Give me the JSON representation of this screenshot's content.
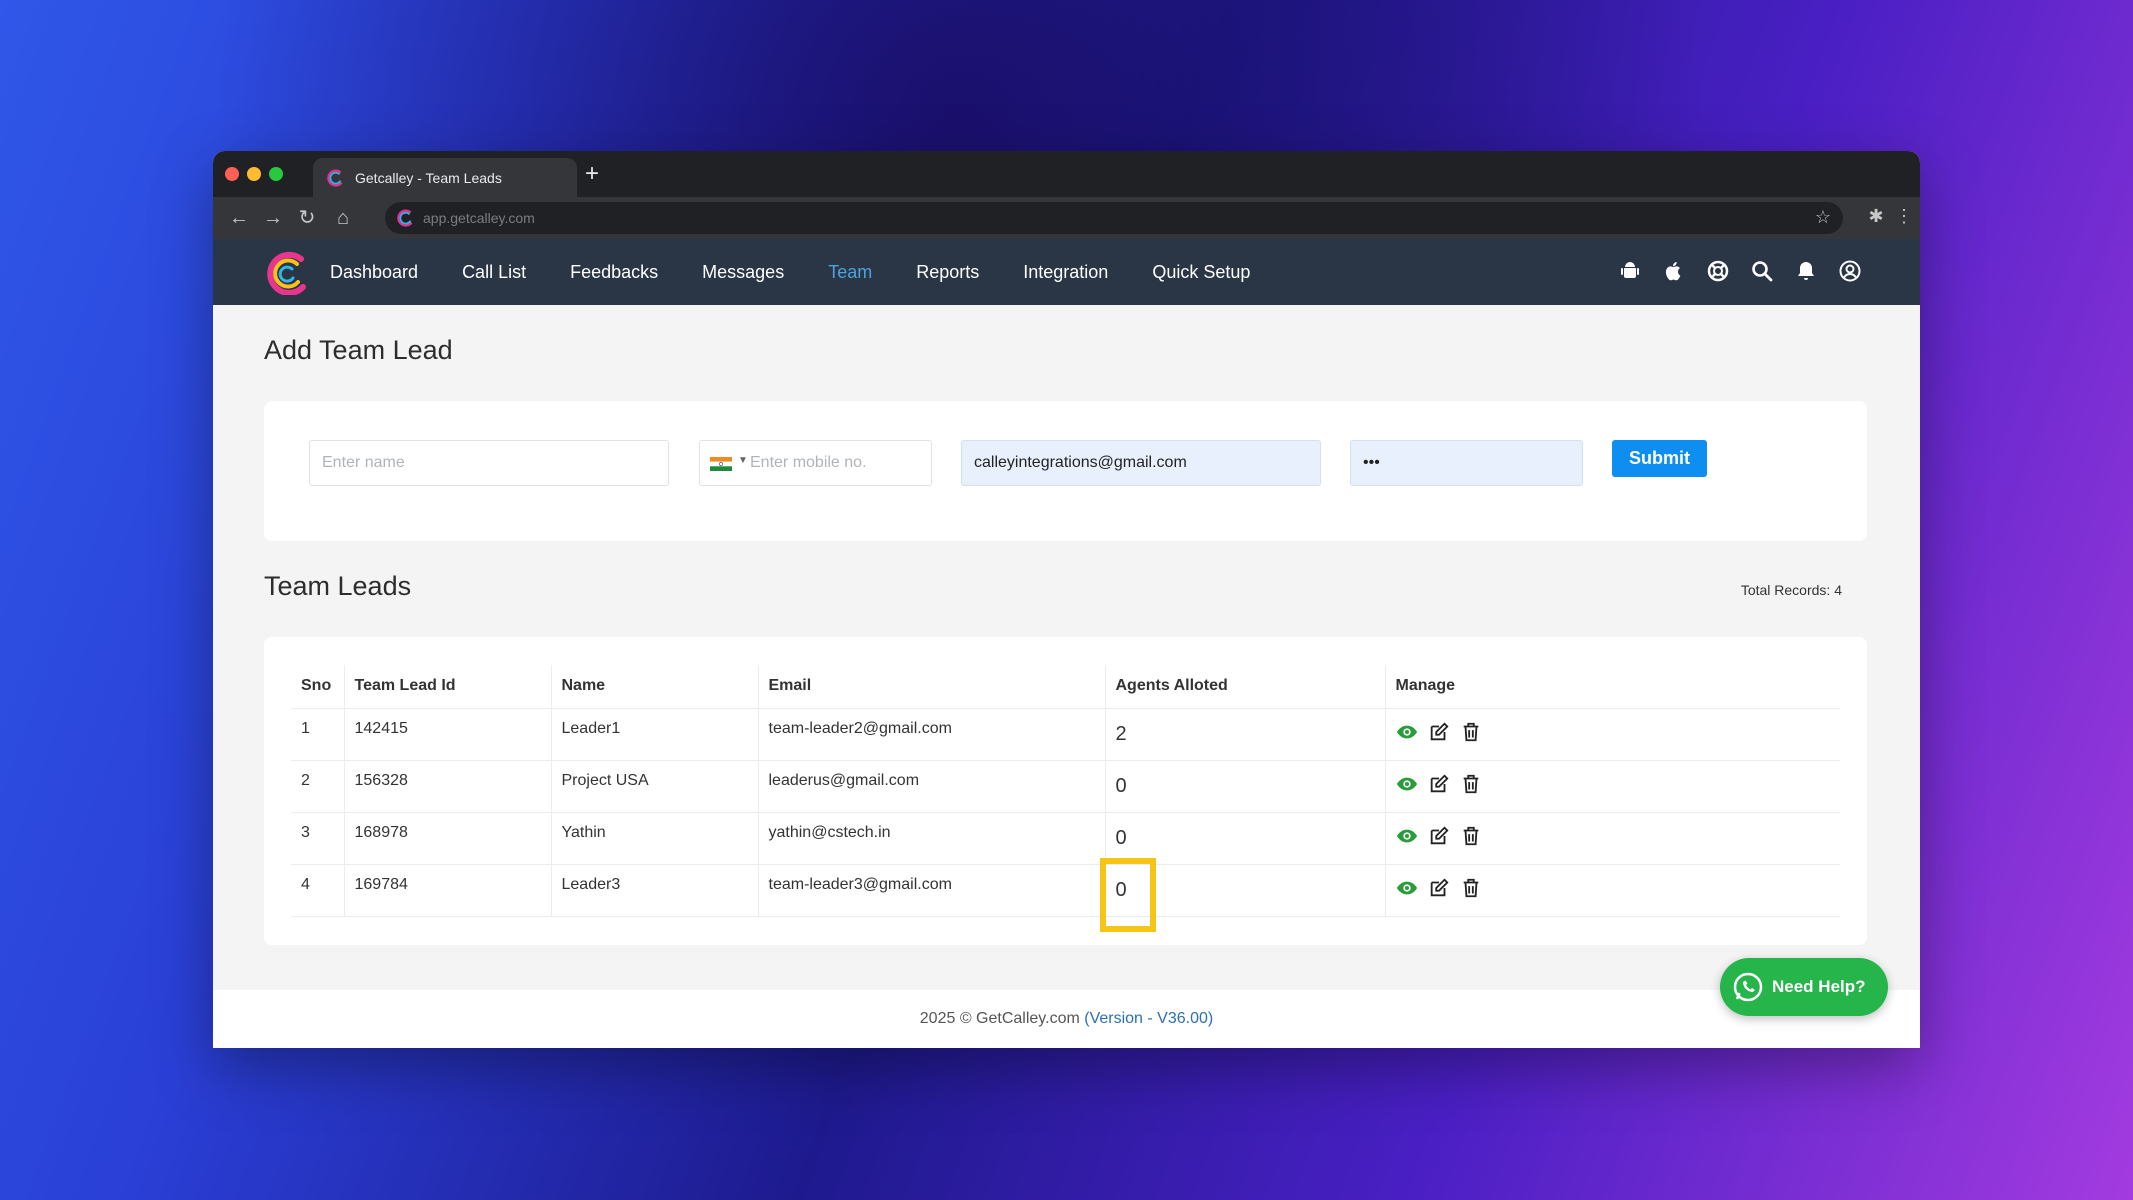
{
  "browser": {
    "tab_title": "Getcalley - Team Leads",
    "new_tab": "+",
    "url": "app.getcalley.com"
  },
  "nav": {
    "links": [
      "Dashboard",
      "Call List",
      "Feedbacks",
      "Messages",
      "Team",
      "Reports",
      "Integration",
      "Quick Setup"
    ],
    "active": "Team",
    "icons": [
      "android-icon",
      "apple-icon",
      "help-lifebuoy-icon",
      "search-icon",
      "bell-icon",
      "user-icon"
    ]
  },
  "form": {
    "title": "Add Team Lead",
    "name_placeholder": "Enter name",
    "mobile_placeholder": "Enter mobile no.",
    "email_value": "calleyintegrations@gmail.com",
    "password_value": "•••",
    "submit_label": "Submit"
  },
  "team_leads": {
    "title": "Team Leads",
    "total_records": "Total Records: 4",
    "columns": [
      "Sno",
      "Team Lead Id",
      "Name",
      "Email",
      "Agents Alloted",
      "Manage"
    ],
    "rows": [
      {
        "sno": "1",
        "id": "142415",
        "name": "Leader1",
        "email": "team-leader2@gmail.com",
        "agents": "2"
      },
      {
        "sno": "2",
        "id": "156328",
        "name": "Project USA",
        "email": "leaderus@gmail.com",
        "agents": "0"
      },
      {
        "sno": "3",
        "id": "168978",
        "name": "Yathin",
        "email": "yathin@cstech.in",
        "agents": "0"
      },
      {
        "sno": "4",
        "id": "169784",
        "name": "Leader3",
        "email": "team-leader3@gmail.com",
        "agents": "0"
      }
    ],
    "highlighted_row": 4
  },
  "footer": {
    "copyright": "2025 © GetCalley.com",
    "version": "(Version - V36.00)"
  },
  "help": {
    "label": "Need Help?"
  },
  "colors": {
    "navbar": "#2a3545",
    "active_link": "#4aa3df",
    "submit": "#0d8ef0",
    "highlight": "#f5c518",
    "help": "#25b54a",
    "view_icon": "#2a9d3a"
  }
}
